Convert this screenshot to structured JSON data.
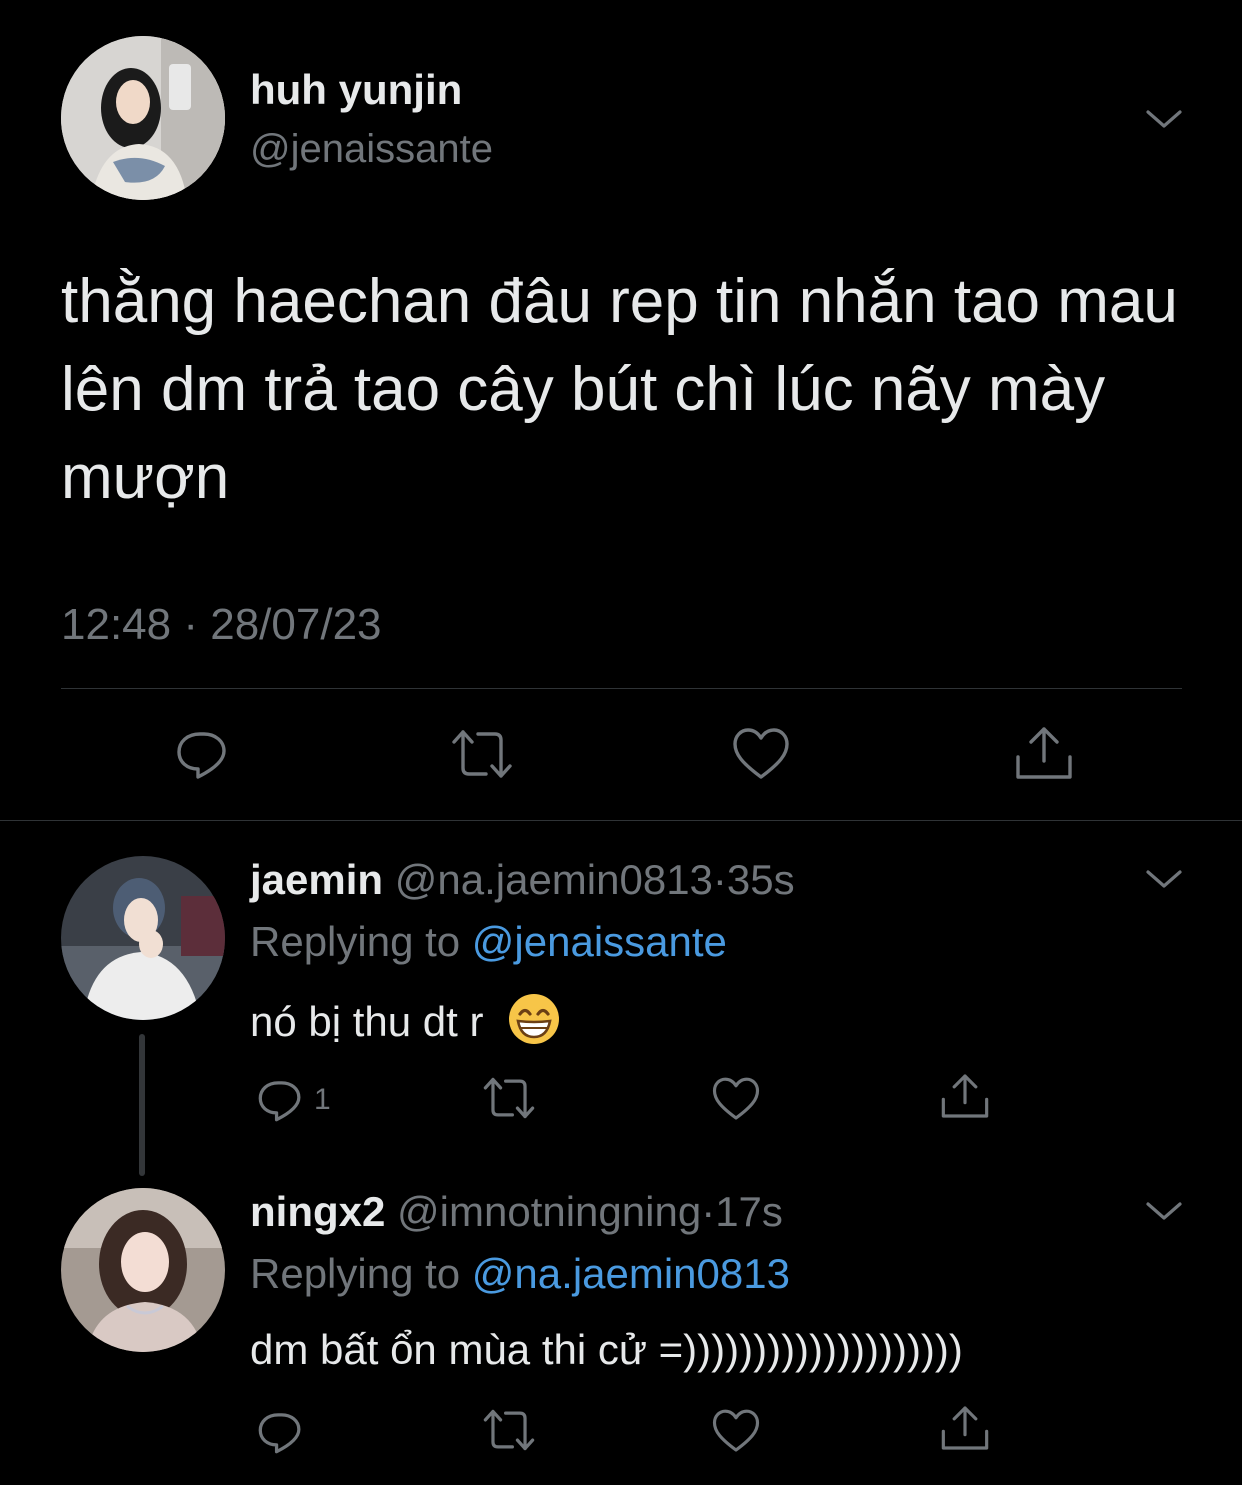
{
  "main_tweet": {
    "author_name": "huh yunjin",
    "handle": "@jenaissante",
    "text": "thằng haechan đâu rep tin nhắn tao mau lên dm trả tao cây bút chì lúc nãy mày mượn",
    "time": "12:48",
    "separator": "·",
    "date": "28/07/23",
    "actions": [
      "reply-icon",
      "retweet-icon",
      "like-icon",
      "share-icon"
    ]
  },
  "replies": [
    {
      "author_name": "jaemin",
      "handle": "@na.jaemin0813",
      "separator": "·",
      "time_ago": "35s",
      "replying_prefix": "Replying to",
      "replying_to": "@jenaissante",
      "text": "nó bị thu dt r",
      "emoji": "😁",
      "reply_count": "1"
    },
    {
      "author_name": "ningx2",
      "handle": "@imnotningning",
      "separator": "·",
      "time_ago": "17s",
      "replying_prefix": "Replying to",
      "replying_to": "@na.jaemin0813",
      "text": "dm bất ổn mùa thi cử =))))))))))))))))))))"
    }
  ],
  "colors": {
    "background": "#000000",
    "text": "#e7e9ea",
    "secondary": "#71767b",
    "link": "#4a9ae0",
    "divider": "#2f3336"
  }
}
